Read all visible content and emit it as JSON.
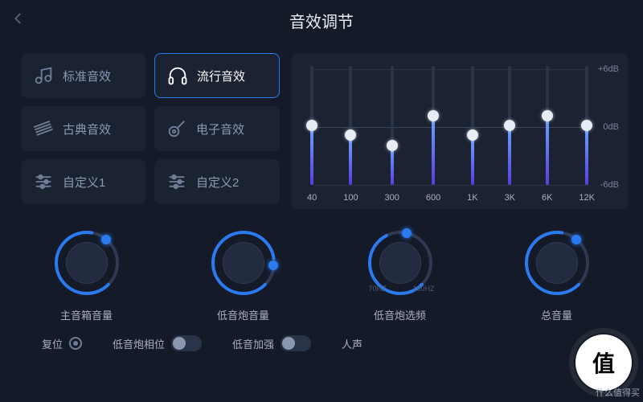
{
  "header": {
    "title": "音效调节"
  },
  "presets": [
    {
      "label": "标准音效",
      "icon": "note"
    },
    {
      "label": "流行音效",
      "icon": "headphones",
      "active": true
    },
    {
      "label": "古典音效",
      "icon": "piano"
    },
    {
      "label": "电子音效",
      "icon": "guitar"
    },
    {
      "label": "自定义1",
      "icon": "sliders"
    },
    {
      "label": "自定义2",
      "icon": "sliders"
    }
  ],
  "eq": {
    "db_labels": {
      "plus": "+6dB",
      "zero": "0dB",
      "minus": "-6dB"
    },
    "bands": [
      {
        "freq": "40",
        "value": 0
      },
      {
        "freq": "100",
        "value": -1
      },
      {
        "freq": "300",
        "value": -2
      },
      {
        "freq": "600",
        "value": 1
      },
      {
        "freq": "1K",
        "value": -1
      },
      {
        "freq": "3K",
        "value": 0
      },
      {
        "freq": "6K",
        "value": 1
      },
      {
        "freq": "12K",
        "value": 0
      }
    ]
  },
  "knobs": [
    {
      "label": "主音箱音量",
      "value": 0.65,
      "angle": 20
    },
    {
      "label": "低音炮音量",
      "value": 0.85,
      "angle": -40
    },
    {
      "label": "低音炮选频",
      "value": 0.55,
      "angle": 60,
      "hint_left": "70HZ",
      "hint_right": "160HZ"
    },
    {
      "label": "总音量",
      "value": 0.65,
      "angle": 20
    }
  ],
  "bottom": {
    "reset": "复位",
    "phase": "低音炮相位",
    "bass_boost": "低音加强",
    "vocal": "人声"
  },
  "watermark": {
    "char": "值",
    "sub": "什么值得买"
  },
  "colors": {
    "accent": "#2a7af0",
    "bg": "#141a28",
    "panel": "#1b2333"
  }
}
